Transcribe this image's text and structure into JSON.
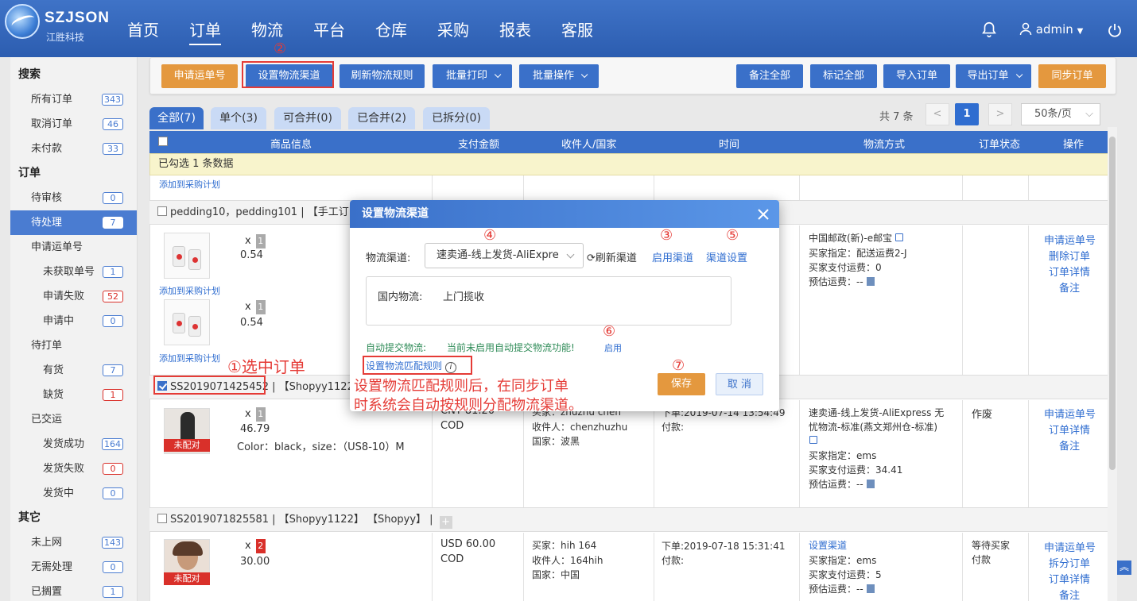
{
  "app": {
    "logo_en": "SZJSON",
    "logo_cn": "江胜科技",
    "user": "admin"
  },
  "nav": [
    "首页",
    "订单",
    "物流",
    "平台",
    "仓库",
    "采购",
    "报表",
    "客服"
  ],
  "sidebar": {
    "search_head": "搜索",
    "search_items": [
      {
        "label": "所有订单",
        "count": "343"
      },
      {
        "label": "取消订单",
        "count": "46"
      },
      {
        "label": "未付款",
        "count": "33"
      }
    ],
    "order_head": "订单",
    "order_items": [
      {
        "label": "待审核",
        "count": "0"
      },
      {
        "label": "待处理",
        "count": "7"
      },
      {
        "label": "申请运单号",
        "count": ""
      },
      {
        "label": "未获取单号",
        "count": "1"
      },
      {
        "label": "申请失败",
        "count": "52"
      },
      {
        "label": "申请中",
        "count": "0"
      },
      {
        "label": "待打单",
        "count": ""
      },
      {
        "label": "有货",
        "count": "7"
      },
      {
        "label": "缺货",
        "count": "1"
      },
      {
        "label": "已交运",
        "count": ""
      },
      {
        "label": "发货成功",
        "count": "164"
      },
      {
        "label": "发货失败",
        "count": "0"
      },
      {
        "label": "发货中",
        "count": "0"
      }
    ],
    "other_head": "其它",
    "other_items": [
      {
        "label": "未上网",
        "count": "143"
      },
      {
        "label": "无需处理",
        "count": "0"
      },
      {
        "label": "已搁置",
        "count": "1"
      }
    ]
  },
  "toolbar": {
    "apply_waybill": "申请运单号",
    "set_channel": "设置物流渠道",
    "refresh_rules": "刷新物流规则",
    "batch_print": "批量打印",
    "batch_ops": "批量操作",
    "remark_all": "备注全部",
    "mark_all": "标记全部",
    "import_orders": "导入订单",
    "export_orders": "导出订单",
    "sync_orders": "同步订单"
  },
  "tabs": [
    "全部(7)",
    "单个(3)",
    "可合并(0)",
    "已合并(2)",
    "已拆分(0)"
  ],
  "pager": {
    "total": "共 7 条",
    "page": "1",
    "size": "50条/页",
    "prev": "<",
    "next": ">"
  },
  "table": {
    "headers": [
      "商品信息",
      "支付金额",
      "收件人/国家",
      "时间",
      "物流方式",
      "订单状态",
      "操作"
    ],
    "selected_msg": "已勾选 1 条数据",
    "add_to_purchase": "添加到采购计划",
    "group1": "pedding10，pedding101  |  【手工订",
    "row1": {
      "qty1": "1",
      "price1": "0.54",
      "qty2": "1",
      "price2": "0.54",
      "logistics": [
        "中国邮政(新)-e邮宝",
        "买家指定：配送运费2-J",
        "买家支付运费：0",
        "预估运费：--"
      ],
      "actions": [
        "申请运单号",
        "删除订单",
        "订单详情",
        "备注"
      ]
    },
    "group2_id": "SS2019071425452",
    "group2_rest": "  |  【Shopyy1122",
    "row2": {
      "unmatched": "未配对",
      "x": "x",
      "qty": "1",
      "price": "46.79",
      "variant": "Color：black，size：（US8-10）M",
      "amount": [
        "CNY  81.20",
        "COD"
      ],
      "recipient": [
        "买家：zhuzhu chen",
        "收件人：chenzhuzhu",
        "国家：波黑"
      ],
      "time": [
        "下单:2019-07-14 13:54:49",
        "付款:"
      ],
      "logistics": [
        "速卖通-线上发货-AliExpress 无",
        "忧物流-标准(燕文郑州仓-标准)",
        "买家指定：ems",
        "买家支付运费：34.41",
        "预估运费：--"
      ],
      "status": "作废",
      "actions": [
        "申请运单号",
        "订单详情",
        "备注"
      ]
    },
    "group3": "SS2019071825581  |  【Shopyy1122】  【Shopyy】  |",
    "row3": {
      "unmatched": "未配对",
      "qty": "2",
      "price": "30.00",
      "amount": [
        "USD  60.00",
        "COD"
      ],
      "recipient": [
        "买家：hih 164",
        "收件人：164hih",
        "国家：中国"
      ],
      "time": [
        "下单:2019-07-18 15:31:41",
        "付款:"
      ],
      "logistics": [
        "设置渠道",
        "买家指定：ems",
        "买家支付运费：5",
        "预估运费：--"
      ],
      "status": [
        "等待买家",
        "付款"
      ],
      "actions": [
        "申请运单号",
        "拆分订单",
        "订单详情",
        "备注"
      ]
    }
  },
  "modal": {
    "title": "设置物流渠道",
    "channel_label": "物流渠道:",
    "channel_value": "速卖通-线上发货-AliExpre",
    "refresh": "刷新渠道",
    "enable": "启用渠道",
    "settings": "渠道设置",
    "domestic_label": "国内物流:",
    "domestic_value": "上门揽收",
    "auto_submit_label": "自动提交物流:",
    "auto_submit_msg": "当前未启用自动提交物流功能!",
    "auto_submit_enable": "启用",
    "rule_link": "设置物流匹配规则",
    "save": "保存",
    "cancel": "取 消"
  },
  "annotations": {
    "n1": "①选中订单",
    "n2": "②",
    "n3": "③",
    "n4": "④",
    "n5": "⑤",
    "n6": "⑥",
    "n7": "⑦",
    "note_line1": "设置物流匹配规则后，在同步订单",
    "note_line2": "时系统会自动按规则分配物流渠道。"
  },
  "colors": {
    "primary": "#3a70c9",
    "orange": "#e4983e",
    "annotation": "#e53b36",
    "link": "#2f6dd0"
  }
}
